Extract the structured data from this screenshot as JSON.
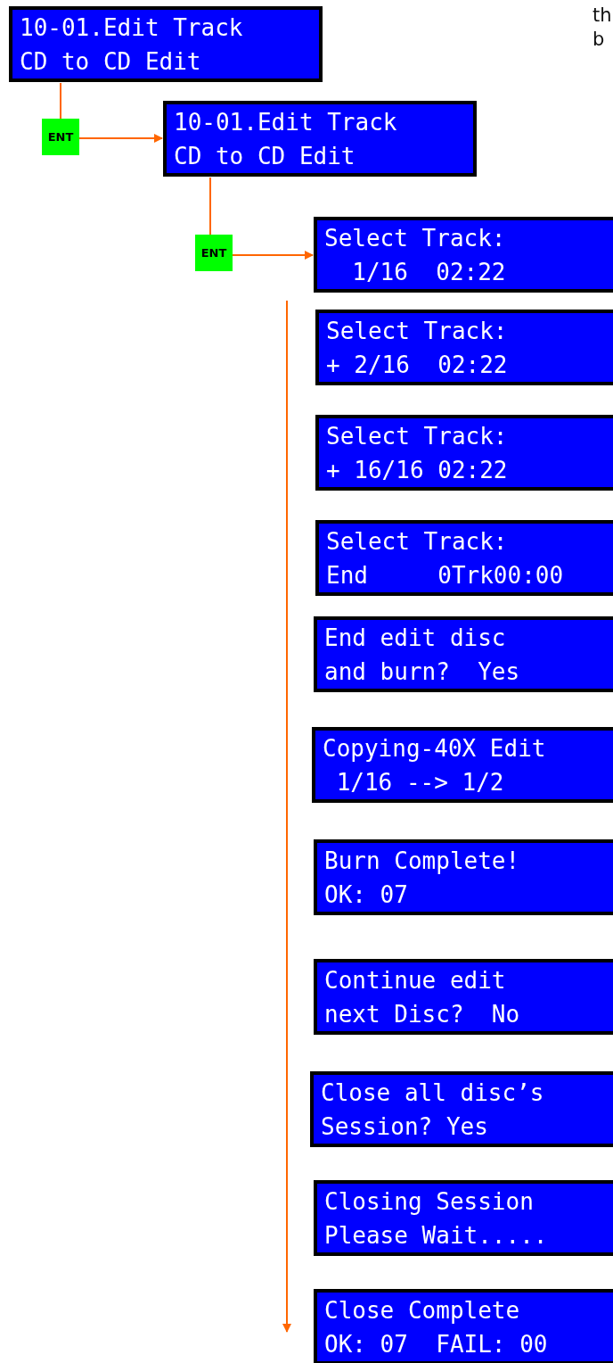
{
  "note_lines": [
    "th",
    "b"
  ],
  "ent_keys": [
    {
      "label": "ENT"
    },
    {
      "label": "ENT"
    }
  ],
  "screens": [
    {
      "lines": [
        "10-01.Edit Track",
        "CD to CD Edit"
      ]
    },
    {
      "lines": [
        "10-01.Edit Track",
        "CD to CD Edit"
      ]
    },
    {
      "lines": [
        "Select Track:",
        "  1/16  02:22"
      ]
    },
    {
      "lines": [
        "Select Track:",
        "+ 2/16  02:22"
      ]
    },
    {
      "lines": [
        "Select Track:",
        "+ 16/16 02:22"
      ]
    },
    {
      "lines": [
        "Select Track:",
        "End     0Trk00:00"
      ]
    },
    {
      "lines": [
        "End edit disc",
        "and burn?  Yes"
      ]
    },
    {
      "lines": [
        "Copying-40X Edit",
        " 1/16 --> 1/2"
      ]
    },
    {
      "lines": [
        "Burn Complete!",
        "OK: 07"
      ]
    },
    {
      "lines": [
        "Continue edit",
        "next Disc?  No"
      ]
    },
    {
      "lines": [
        "Close all disc’s",
        "Session? Yes"
      ]
    },
    {
      "lines": [
        "Closing Session",
        "Please Wait....."
      ]
    },
    {
      "lines": [
        "Close Complete",
        "OK: 07  FAIL: 00"
      ]
    }
  ]
}
